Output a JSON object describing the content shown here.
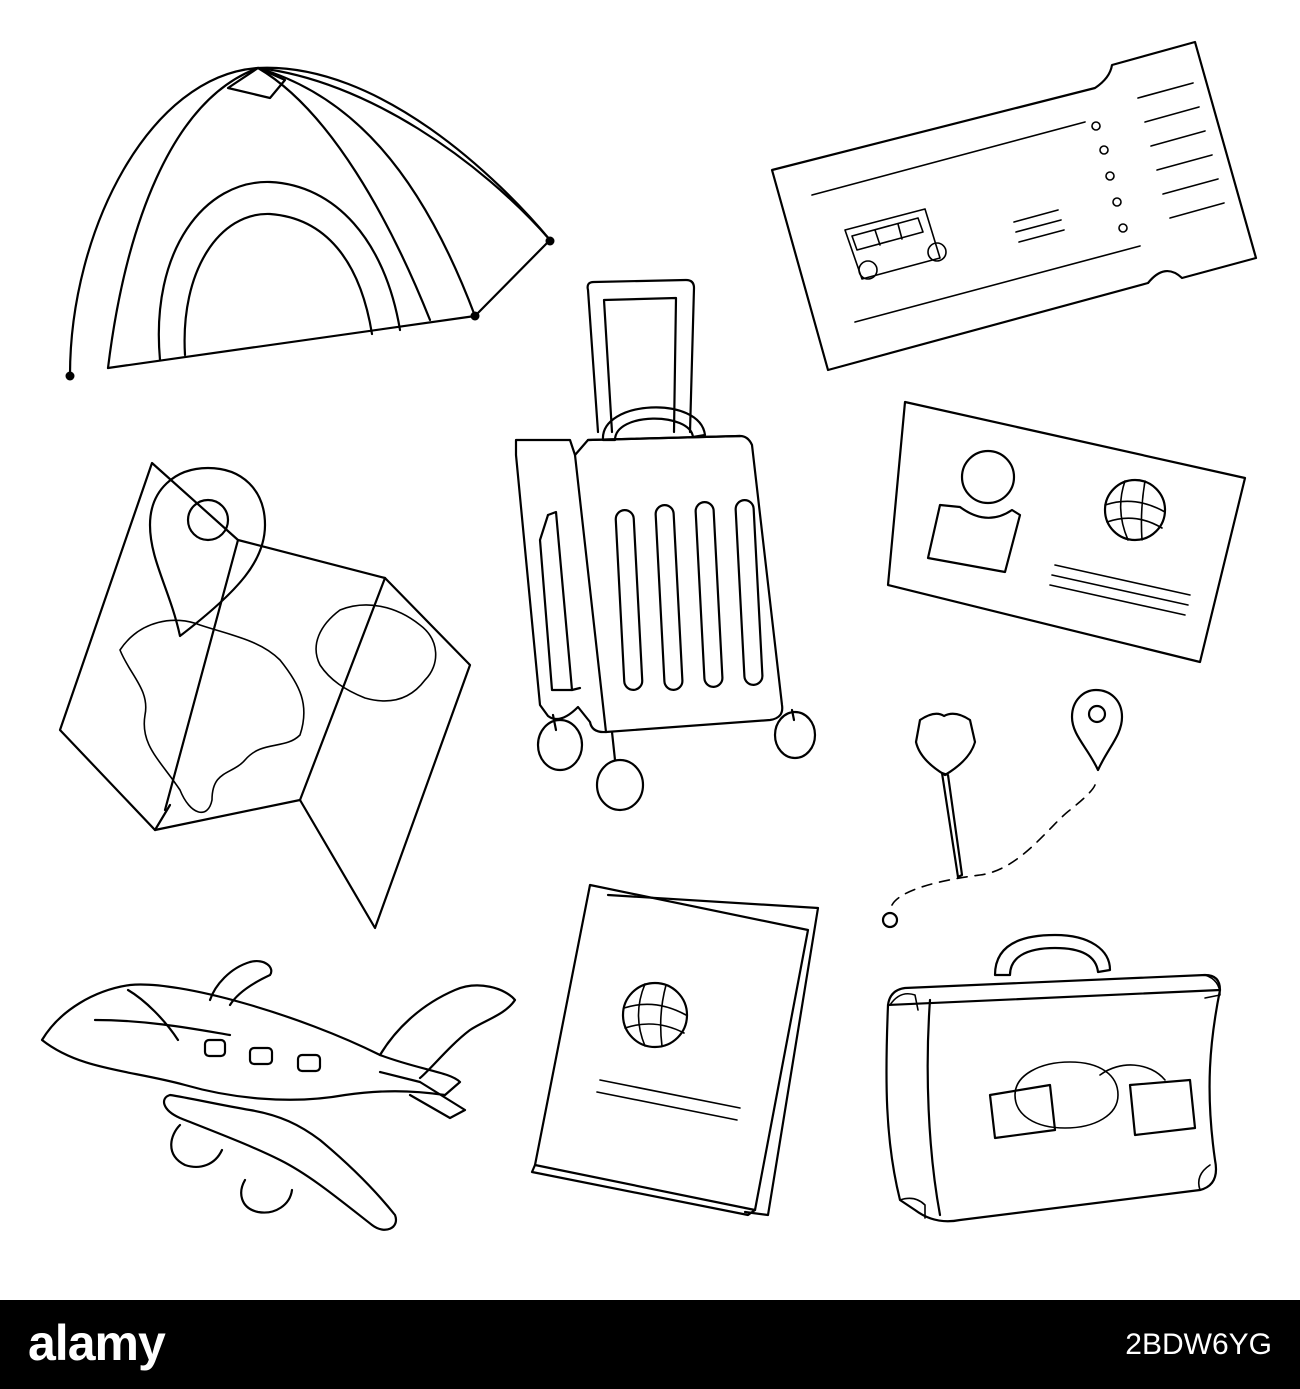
{
  "footer": {
    "brand": "alamy",
    "image_id": "2BDW6YG",
    "background": "#000000",
    "text_color": "#ffffff"
  },
  "illustration": {
    "style": "black line art on white",
    "objects": [
      "tent-icon",
      "bus-ticket-icon",
      "rolling-suitcase-icon",
      "id-card-icon",
      "folded-map-icon",
      "route-pins-icon",
      "airplane-icon",
      "passport-icon",
      "vintage-suitcase-icon"
    ]
  }
}
